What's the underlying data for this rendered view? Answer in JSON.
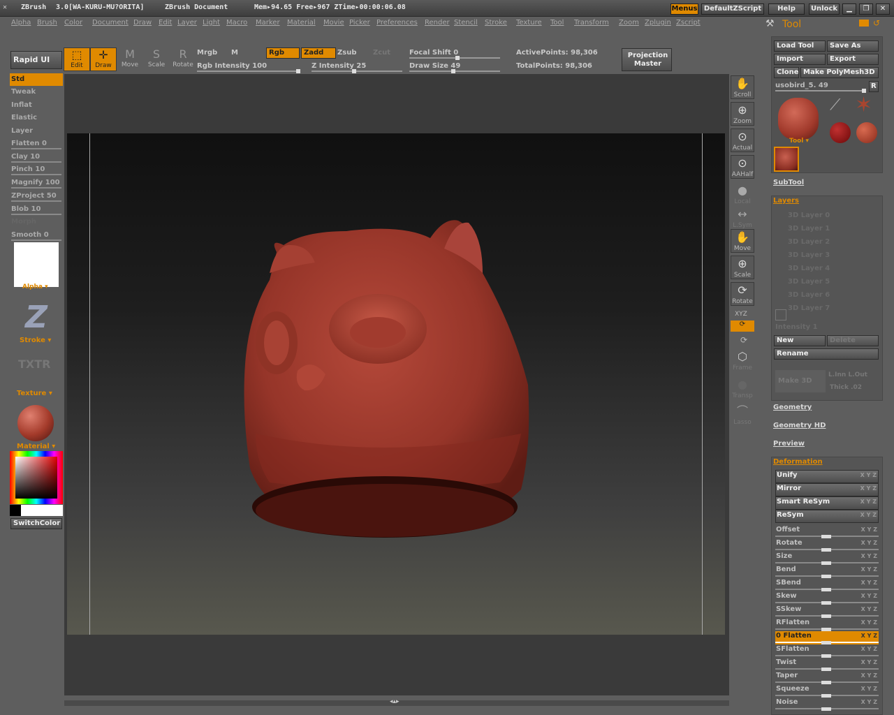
{
  "titlebar": {
    "app": "ZBrush",
    "version": "3.0[WA-KURU-MU?ORITA]",
    "document": "ZBrush Document",
    "stats": "Mem▸94.65 Free▸967 ZTime▸00:00:06.08",
    "menus_btn": "Menus",
    "script_btn": "DefaultZScript",
    "help_btn": "Help",
    "unlock_btn": "Unlock"
  },
  "menubar": [
    "Alpha",
    "Brush",
    "Color",
    "Document",
    "Draw",
    "Edit",
    "Layer",
    "Light",
    "Macro",
    "Marker",
    "Material",
    "Movie",
    "Picker",
    "Preferences",
    "Render",
    "Stencil",
    "Stroke",
    "Texture",
    "Tool",
    "Transform",
    "Zoom",
    "Zplugin",
    "Zscript"
  ],
  "toolbar": {
    "rapid_ui": "Rapid UI",
    "edit": "Edit",
    "draw": "Draw",
    "move": "Move",
    "scale": "Scale",
    "rotate": "Rotate",
    "mrgb": "Mrgb",
    "m": "M",
    "rgb": "Rgb",
    "zadd": "Zadd",
    "zsub": "Zsub",
    "zcut": "Zcut",
    "rgb_intensity": "Rgb Intensity 100",
    "z_intensity": "Z Intensity 25",
    "focal_shift": "Focal Shift 0",
    "draw_size": "Draw Size 49",
    "active_points": "ActivePoints: 98,306",
    "total_points": "TotalPoints: 98,306",
    "projection_master": "Projection Master"
  },
  "left_shelf": {
    "brushes": [
      {
        "label": "Std",
        "state": "selected"
      },
      {
        "label": "Tweak",
        "state": "normal"
      },
      {
        "label": "Inflat",
        "state": "normal"
      },
      {
        "label": "Elastic",
        "state": "normal"
      },
      {
        "label": "Layer",
        "state": "normal"
      },
      {
        "label": "Flatten 0",
        "state": "slider"
      },
      {
        "label": "Clay 10",
        "state": "slider"
      },
      {
        "label": "Pinch 10",
        "state": "slider"
      },
      {
        "label": "Magnify 100",
        "state": "slider"
      },
      {
        "label": "ZProject 50",
        "state": "slider"
      },
      {
        "label": "Blob 10",
        "state": "slider"
      },
      {
        "label": "Morph",
        "state": "dim"
      },
      {
        "label": "Smooth 0",
        "state": "slider"
      }
    ],
    "alpha_label": "Alpha",
    "stroke_label": "Stroke",
    "texture_icon": "TXTR",
    "texture_label": "Texture",
    "material_label": "Material",
    "switch_color": "SwitchColor"
  },
  "right_shelf": [
    {
      "label": "Scroll",
      "icon": "hand-icon",
      "glyph": "✋"
    },
    {
      "label": "Zoom",
      "icon": "zoom-icon",
      "glyph": "🔍"
    },
    {
      "label": "Actual",
      "icon": "actual-icon",
      "glyph": "🔍"
    },
    {
      "label": "AAHalf",
      "icon": "aahalf-icon",
      "glyph": "🔍"
    },
    {
      "label": "Local",
      "icon": "local-icon",
      "glyph": "●"
    },
    {
      "label": "L.Sym",
      "icon": "lsym-icon",
      "glyph": "↔"
    },
    {
      "label": "Move",
      "icon": "move-icon",
      "glyph": "✋"
    },
    {
      "label": "Scale",
      "icon": "scale-icon",
      "glyph": "🔍"
    },
    {
      "label": "Rotate",
      "icon": "rotate-icon",
      "glyph": "⟳"
    }
  ],
  "right_shelf_extra": {
    "xyz": "XYZ",
    "frame": "Frame",
    "transp": "Transp",
    "lasso": "Lasso"
  },
  "tool_palette": {
    "title": "Tool",
    "load_tool": "Load Tool",
    "save_as": "Save As",
    "import": "Import",
    "export": "Export",
    "clone": "Clone",
    "make_polymesh": "Make PolyMesh3D",
    "current_tool": "usobird_5. 49",
    "r_btn": "R",
    "tool_thumb_label": "Tool",
    "subtool": "SubTool",
    "layers": "Layers",
    "layer_items": [
      "3D Layer 0",
      "3D Layer 1",
      "3D Layer 2",
      "3D Layer 3",
      "3D Layer 4",
      "3D Layer 5",
      "3D Layer 6",
      "3D Layer 7"
    ],
    "intensity": "Intensity 1",
    "new": "New",
    "delete": "Delete",
    "rename": "Rename",
    "make_3d": "Make 3D",
    "inner_outer": "L.Inn L.Out",
    "thick": "Thick .02",
    "geometry": "Geometry",
    "geometry_hd": "Geometry HD",
    "preview": "Preview",
    "deformation": "Deformation",
    "def_buttons": [
      "Unify",
      "Mirror",
      "Smart ReSym",
      "ReSym"
    ],
    "def_sliders": [
      {
        "label": "Offset",
        "state": "normal"
      },
      {
        "label": "Rotate",
        "state": "normal"
      },
      {
        "label": "Size",
        "state": "normal"
      },
      {
        "label": "Bend",
        "state": "normal"
      },
      {
        "label": "SBend",
        "state": "normal"
      },
      {
        "label": "Skew",
        "state": "normal"
      },
      {
        "label": "SSkew",
        "state": "normal"
      },
      {
        "label": "RFlatten",
        "state": "normal"
      },
      {
        "label": "0 Flatten",
        "state": "selected"
      },
      {
        "label": "SFlatten",
        "state": "normal"
      },
      {
        "label": "Twist",
        "state": "normal"
      },
      {
        "label": "Taper",
        "state": "normal"
      },
      {
        "label": "Squeeze",
        "state": "normal"
      },
      {
        "label": "Noise",
        "state": "normal"
      }
    ],
    "axis_labels": "X Y Z"
  },
  "colors": {
    "accent": "#e08a00",
    "model": "#9c3a2c"
  }
}
